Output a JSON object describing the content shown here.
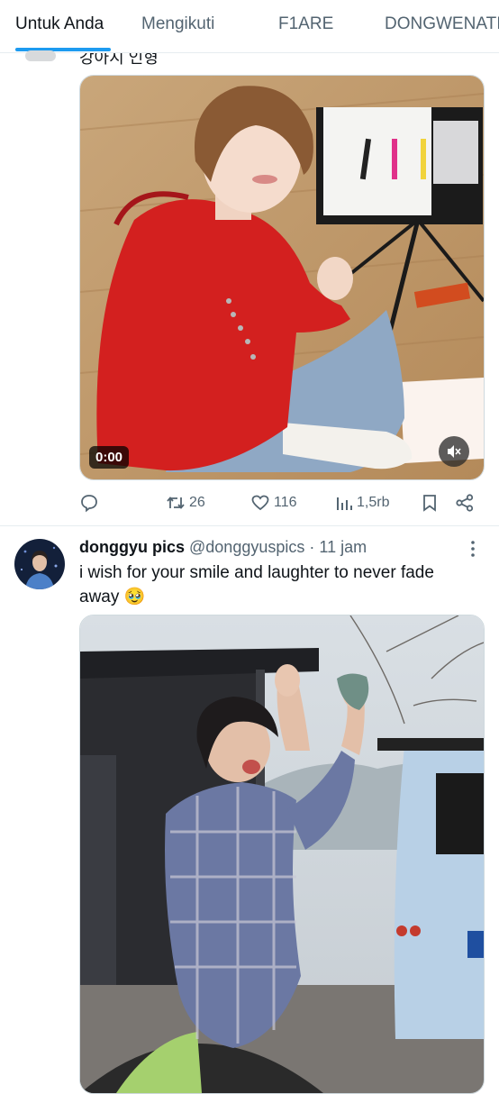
{
  "tabs": [
    {
      "label": "Untuk Anda",
      "active": true
    },
    {
      "label": "Mengikuti",
      "active": false
    },
    {
      "label": "F1ARE",
      "active": false
    },
    {
      "label": "DONGWENATI",
      "active": false
    }
  ],
  "prev_tweet": {
    "text_remnant": "강아지 인형",
    "video_time": "0:00",
    "actions": {
      "replies": "",
      "retweets": "26",
      "likes": "116",
      "views": "1,5rb"
    }
  },
  "tweet": {
    "name": "donggyu pics",
    "handle": "@donggyuspics",
    "separator": "·",
    "time": "11 jam",
    "text": "i wish for your smile and laughter to never fade away 🥹"
  },
  "colors": {
    "accent": "#1d9bf0",
    "muted": "#536471",
    "text": "#0f1419"
  }
}
